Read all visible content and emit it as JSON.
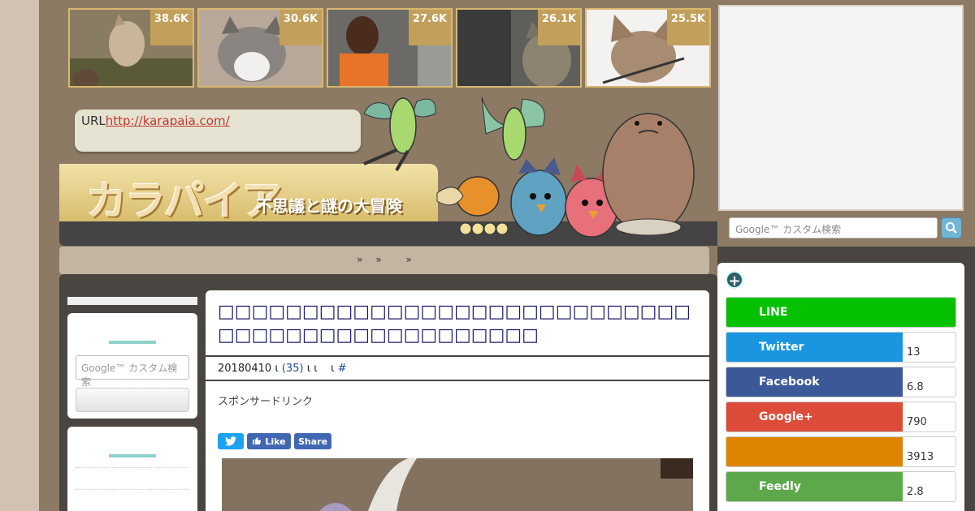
{
  "thumbnails": [
    {
      "count": "38.6K",
      "desc": "wolf howling with man"
    },
    {
      "count": "30.6K",
      "desc": "tabby kitten"
    },
    {
      "count": "27.6K",
      "desc": "man in orange"
    },
    {
      "count": "26.1K",
      "desc": "cat on car seat"
    },
    {
      "count": "25.5K",
      "desc": "cat with stick"
    }
  ],
  "header": {
    "url_label": "URL",
    "url_link": "http://karapaia.com/",
    "logo": "カラパイア",
    "tagline": "不思議と謎の大冒険"
  },
  "breadcrumb": [
    "»",
    "»",
    "»"
  ],
  "search": {
    "top_placeholder": "Google™ カスタム検索",
    "left_placeholder": "Google™ カスタム検索"
  },
  "article": {
    "title": "□□□□□□□□□□□□□□□□□□□□□□□□□□□□□□□□□□□□□□□□□□□□□□□",
    "meta_date": "20180410",
    "meta_sep1": "ι",
    "meta_count": "(35)",
    "meta_sep2": "ι ι",
    "meta_sep3": "ι",
    "meta_hash": "#",
    "sponsor": "スポンサードリンク",
    "social": {
      "tweet": "",
      "like": "Like",
      "share": "Share"
    }
  },
  "share_panel": {
    "items": [
      {
        "name": "LINE",
        "count": "",
        "color": "#06c100"
      },
      {
        "name": "Twitter",
        "count": "13",
        "color": "#1b95e0"
      },
      {
        "name": "Facebook",
        "count": "6.8",
        "color": "#3b5998"
      },
      {
        "name": "Google+",
        "count": "790",
        "color": "#dd4b39"
      },
      {
        "name": "",
        "count": "3913",
        "color": "#de8400"
      },
      {
        "name": "Feedly",
        "count": "2.8",
        "color": "#5ca84b"
      }
    ]
  }
}
